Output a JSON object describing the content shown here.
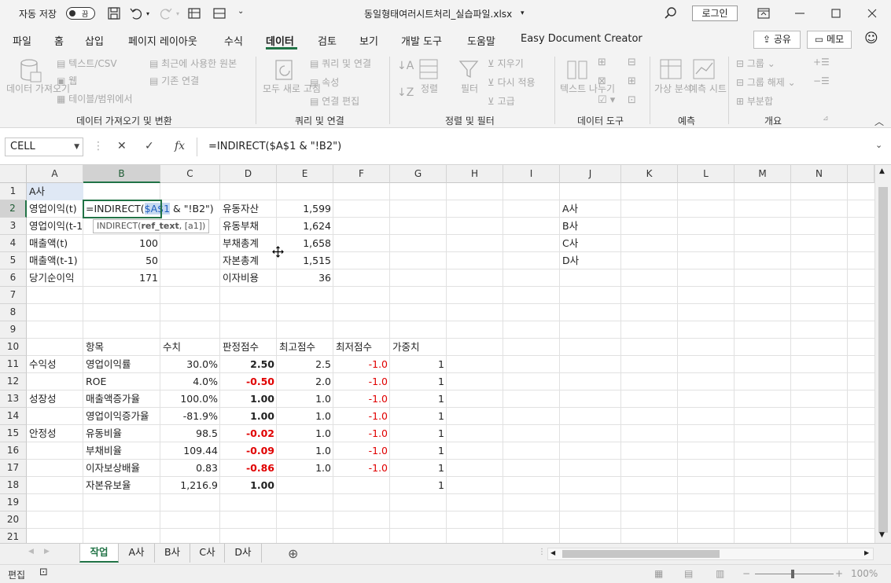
{
  "titlebar": {
    "autosave_label": "자동 저장",
    "autosave_state": "끔",
    "filename": "동일형태여러시트처리_실습파일.xlsx",
    "login_label": "로그인"
  },
  "tabs": [
    "파일",
    "홈",
    "삽입",
    "페이지 레이아웃",
    "수식",
    "데이터",
    "검토",
    "보기",
    "개발 도구",
    "도움말",
    "Easy Document Creator"
  ],
  "active_tab": "데이터",
  "share_label": "공유",
  "memo_label": "메모",
  "ribbon": {
    "get_data": "데이터 가져오기",
    "from_text_csv": "텍스트/CSV",
    "from_web": "웹",
    "from_table": "테이블/범위에서",
    "recent_sources": "최근에 사용한 원본",
    "existing_connections": "기존 연결",
    "group1_label": "데이터 가져오기 및 변환",
    "refresh_all": "모두 새로 고침",
    "queries_connections": "쿼리 및 연결",
    "properties": "속성",
    "edit_links": "연결 편집",
    "group2_label": "쿼리 및 연결",
    "sort": "정렬",
    "filter": "필터",
    "clear": "지우기",
    "reapply": "다시 적용",
    "advanced": "고급",
    "group3_label": "정렬 및 필터",
    "text_to_columns": "텍스트 나누기",
    "group4_label": "데이터 도구",
    "what_if": "가상 분석",
    "forecast_sheet": "예측 시트",
    "group5_label": "예측",
    "group_btn": "그룹",
    "ungroup_btn": "그룹 해제",
    "subtotal": "부분합",
    "group6_label": "개요"
  },
  "formula_bar": {
    "name_box": "CELL",
    "formula": "=INDIRECT($A$1 & \"!B2\")"
  },
  "columns": [
    "A",
    "B",
    "C",
    "D",
    "E",
    "F",
    "G",
    "H",
    "I",
    "J",
    "K",
    "L",
    "M",
    "N"
  ],
  "rows": [
    "1",
    "2",
    "3",
    "4",
    "5",
    "6",
    "7",
    "8",
    "9",
    "10",
    "11",
    "12",
    "13",
    "14",
    "15",
    "16",
    "17",
    "18",
    "19",
    "20",
    "21"
  ],
  "cells": {
    "A1": "A사",
    "A2": "영업이익(t)",
    "B2_pre": "=INDIRECT(",
    "B2_ref": "$A$1",
    "B2_post": " & \"!B2\")",
    "A3": "영업이익(t-1",
    "A4": "매출액(t)",
    "B4": "100",
    "A5": "매출액(t-1)",
    "B5": "50",
    "A6": "당기순이익",
    "B6": "171",
    "D2": "유동자산",
    "E2": "1,599",
    "D3": "유동부채",
    "E3": "1,624",
    "D4": "부채총계",
    "E4": "1,658",
    "D5": "자본총계",
    "E5": "1,515",
    "D6": "이자비용",
    "E6": "36",
    "J2": "A사",
    "J3": "B사",
    "J4": "C사",
    "J5": "D사"
  },
  "tooltip": {
    "func": "INDIRECT(",
    "arg1": "ref_text",
    "rest": ", [a1])"
  },
  "table_headers": [
    "항목",
    "수치",
    "판정점수",
    "최고점수",
    "최저점수",
    "가중치"
  ],
  "table_rows": [
    {
      "cat": "수익성",
      "item": "영업이익률",
      "val": "30.0%",
      "score": "2.50",
      "score_red": false,
      "max": "2.5",
      "min": "-1.0",
      "w": "1"
    },
    {
      "cat": "",
      "item": "ROE",
      "val": "4.0%",
      "score": "-0.50",
      "score_red": true,
      "max": "2.0",
      "min": "-1.0",
      "w": "1"
    },
    {
      "cat": "성장성",
      "item": "매출액증가율",
      "val": "100.0%",
      "score": "1.00",
      "score_red": false,
      "max": "1.0",
      "min": "-1.0",
      "w": "1"
    },
    {
      "cat": "",
      "item": "영업이익증가율",
      "val": "-81.9%",
      "score": "1.00",
      "score_red": false,
      "max": "1.0",
      "min": "-1.0",
      "w": "1"
    },
    {
      "cat": "안정성",
      "item": "유동비율",
      "val": "98.5",
      "score": "-0.02",
      "score_red": true,
      "max": "1.0",
      "min": "-1.0",
      "w": "1"
    },
    {
      "cat": "",
      "item": "부채비율",
      "val": "109.44",
      "score": "-0.09",
      "score_red": true,
      "max": "1.0",
      "min": "-1.0",
      "w": "1"
    },
    {
      "cat": "",
      "item": "이자보상배율",
      "val": "0.83",
      "score": "-0.86",
      "score_red": true,
      "max": "1.0",
      "min": "-1.0",
      "w": "1"
    },
    {
      "cat": "",
      "item": "자본유보율",
      "val": "1,216.9",
      "score": "1.00",
      "score_red": false,
      "max": "",
      "min": "",
      "w": "1"
    }
  ],
  "sheets": [
    "작업",
    "A사",
    "B사",
    "C사",
    "D사"
  ],
  "active_sheet": "작업",
  "status": {
    "mode": "편집",
    "zoom": "100%"
  },
  "colors": {
    "excel_green": "#217346",
    "negative_red": "#e00000",
    "ref_blue": "#1f5fbf"
  }
}
